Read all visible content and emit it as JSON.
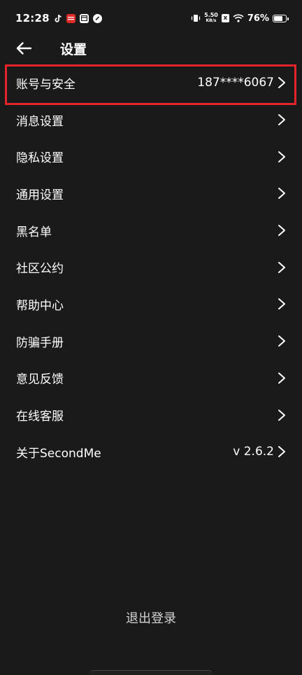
{
  "status_bar": {
    "time": "12:28",
    "net_speed_value": "5.50",
    "net_speed_unit": "KB/s",
    "x_badge": "x",
    "battery_percent": "76%",
    "battery_level": 0.76
  },
  "header": {
    "title": "设置"
  },
  "settings": {
    "items": [
      {
        "label": "账号与安全",
        "value": "187****6067"
      },
      {
        "label": "消息设置",
        "value": ""
      },
      {
        "label": "隐私设置",
        "value": ""
      },
      {
        "label": "通用设置",
        "value": ""
      },
      {
        "label": "黑名单",
        "value": ""
      },
      {
        "label": "社区公约",
        "value": ""
      },
      {
        "label": "帮助中心",
        "value": ""
      },
      {
        "label": "防骗手册",
        "value": ""
      },
      {
        "label": "意见反馈",
        "value": ""
      },
      {
        "label": "在线客服",
        "value": ""
      },
      {
        "label": "关于SecondMe",
        "value": "v 2.6.2"
      }
    ]
  },
  "footer": {
    "logout_label": "退出登录"
  },
  "colors": {
    "background": "#1a1a1a",
    "highlight": "#e3242b"
  },
  "icons": {
    "back": "arrow-left-icon",
    "chevron": "chevron-right-icon"
  }
}
